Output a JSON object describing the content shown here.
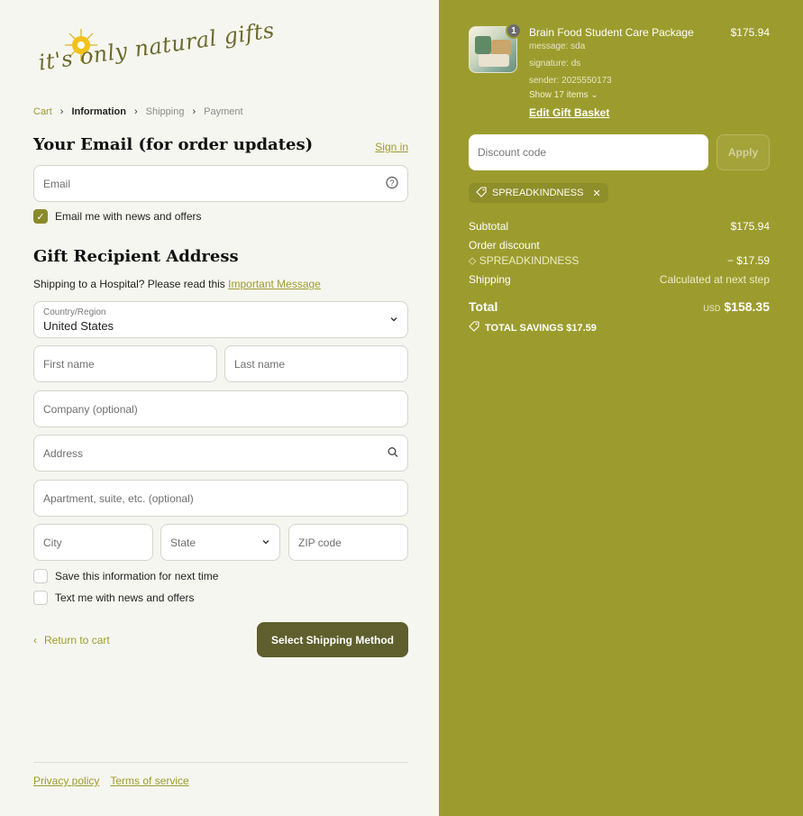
{
  "logo": {
    "text": "it's only natural gifts",
    "sun_color": "#f2c21a"
  },
  "breadcrumb": [
    {
      "label": "Cart",
      "state": "link"
    },
    {
      "label": "Information",
      "state": "active"
    },
    {
      "label": "Shipping",
      "state": "inactive"
    },
    {
      "label": "Payment",
      "state": "inactive"
    }
  ],
  "email_section": {
    "title": "Your Email (for order updates)",
    "signin": "Sign in",
    "email_placeholder": "Email",
    "newsletter_label": "Email me with news and offers",
    "newsletter_checked": true
  },
  "address_section": {
    "title": "Gift Recipient Address",
    "hospital_text": "Shipping to a Hospital? Please read this ",
    "hospital_link": "Important Message",
    "country_label": "Country/Region",
    "country_value": "United States",
    "first_name": "First name",
    "last_name": "Last name",
    "company": "Company (optional)",
    "address": "Address",
    "apartment": "Apartment, suite, etc. (optional)",
    "city": "City",
    "state": "State",
    "zip": "ZIP code",
    "save_info": "Save this information for next time",
    "text_me": "Text me with news and offers"
  },
  "actions": {
    "return": "Return to cart",
    "primary": "Select Shipping Method"
  },
  "footer": {
    "privacy": "Privacy policy",
    "terms": "Terms of service"
  },
  "summary": {
    "product": {
      "name": "Brain Food Student Care Package",
      "price": "$175.94",
      "qty": "1",
      "message": "message: sda",
      "signature": "signature: ds",
      "sender": "sender: 2025550173",
      "show_items": "Show 17 items",
      "edit": "Edit Gift Basket"
    },
    "discount_placeholder": "Discount code",
    "apply": "Apply",
    "code": "SPREADKINDNESS",
    "subtotal_label": "Subtotal",
    "subtotal": "$175.94",
    "order_discount_label": "Order discount",
    "discount_code": "SPREADKINDNESS",
    "discount_amount": "− $17.59",
    "shipping_label": "Shipping",
    "shipping_value": "Calculated at next step",
    "total_label": "Total",
    "currency": "USD",
    "total": "$158.35",
    "savings": "TOTAL SAVINGS  $17.59"
  },
  "colors": {
    "accent": "#9c9c2e",
    "button": "#5e5f2c",
    "panel": "#9c9c2e"
  }
}
